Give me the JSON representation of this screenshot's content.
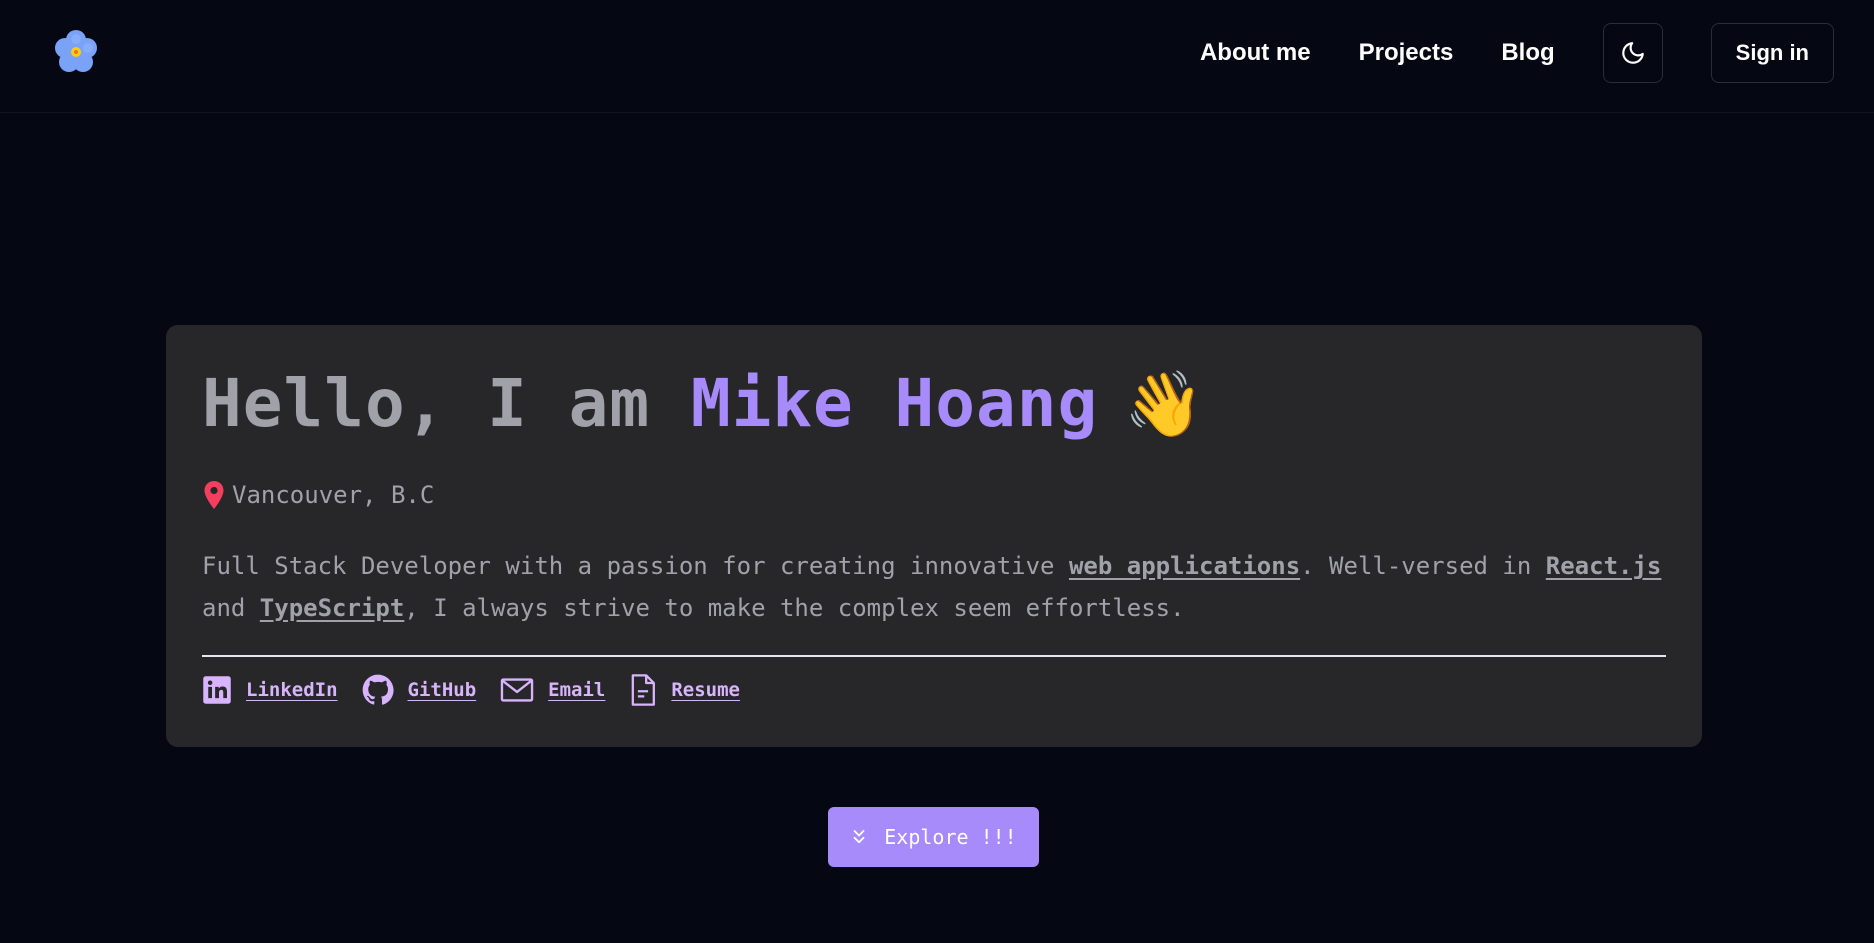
{
  "header": {
    "logo_icon": "forget-me-not-flower-icon",
    "nav": [
      {
        "label": "About me"
      },
      {
        "label": "Projects"
      },
      {
        "label": "Blog"
      }
    ],
    "theme_toggle_icon": "moon-icon",
    "signin_label": "Sign in"
  },
  "hero": {
    "greeting": "Hello, I am ",
    "name": "Mike Hoang",
    "wave_emoji": "👋",
    "location": "Vancouver, B.C",
    "bio": {
      "part1": "Full Stack Developer with a passion for creating innovative ",
      "link1": "web applications",
      "part2": ". Well-versed in ",
      "link2": "React.js",
      "part3": " and ",
      "link3": "TypeScript",
      "part4": ", I always strive to make the complex seem effortless."
    },
    "socials": [
      {
        "label": "LinkedIn",
        "icon": "linkedin-icon"
      },
      {
        "label": "GitHub",
        "icon": "github-icon"
      },
      {
        "label": "Email",
        "icon": "mail-icon"
      },
      {
        "label": "Resume",
        "icon": "document-icon"
      }
    ]
  },
  "explore_label": "Explore !!!",
  "colors": {
    "background": "#050712",
    "card": "#27272a",
    "accent": "#a78bfa",
    "link": "#d8b4fe",
    "pin": "#f43f5e"
  }
}
